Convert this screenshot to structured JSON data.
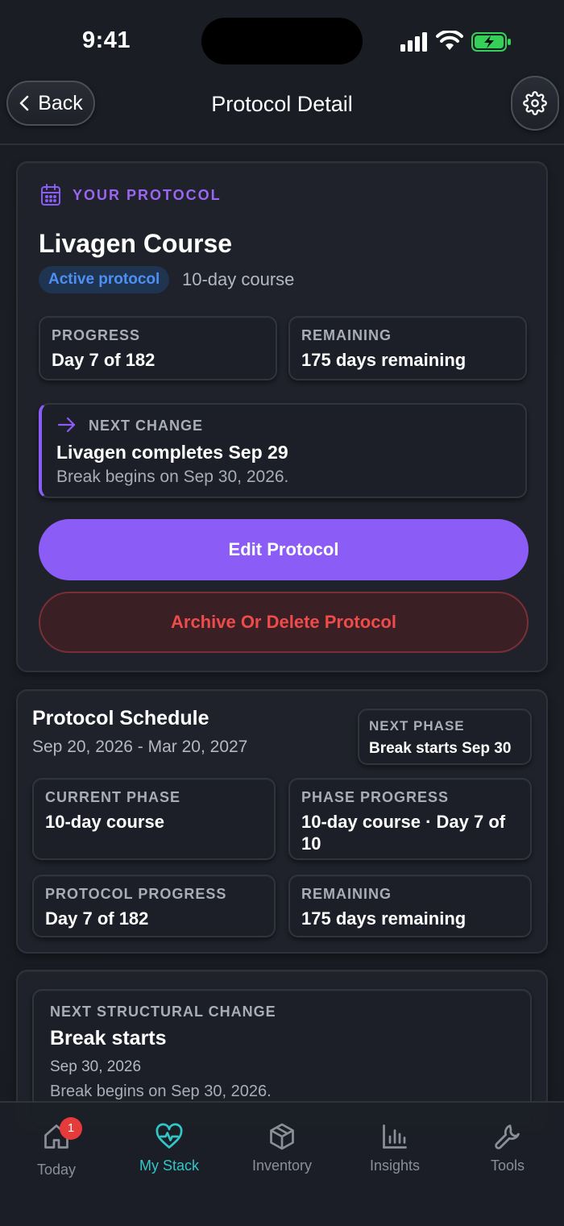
{
  "status": {
    "time": "9:41"
  },
  "nav": {
    "back_label": "Back",
    "title": "Protocol Detail"
  },
  "protocol": {
    "section_label": "YOUR PROTOCOL",
    "title": "Livagen Course",
    "badge": "Active protocol",
    "course": "10-day course",
    "progress": {
      "label": "PROGRESS",
      "value": "Day 7 of 182"
    },
    "remaining": {
      "label": "REMAINING",
      "value": "175 days remaining"
    },
    "next_change": {
      "label": "NEXT CHANGE",
      "title": "Livagen completes Sep 29",
      "subtitle": "Break begins on Sep 30, 2026."
    },
    "edit_label": "Edit Protocol",
    "archive_label": "Archive Or Delete Protocol"
  },
  "schedule": {
    "title": "Protocol Schedule",
    "range": "Sep 20, 2026 - Mar 20, 2027",
    "next_phase": {
      "label": "NEXT PHASE",
      "value": "Break starts Sep 30"
    },
    "current_phase": {
      "label": "CURRENT PHASE",
      "value": "10-day course"
    },
    "phase_progress": {
      "label": "PHASE PROGRESS",
      "value": "10-day course · Day 7 of 10"
    },
    "protocol_progress": {
      "label": "PROTOCOL PROGRESS",
      "value": "Day 7 of 182"
    },
    "remaining": {
      "label": "REMAINING",
      "value": "175 days remaining"
    }
  },
  "structural": {
    "label": "NEXT STRUCTURAL CHANGE",
    "title": "Break starts",
    "date": "Sep 30, 2026",
    "subtitle": "Break begins on Sep 30, 2026."
  },
  "tabs": [
    {
      "label": "Today",
      "icon": "home-icon",
      "badge": "1"
    },
    {
      "label": "My Stack",
      "icon": "heart-pulse-icon",
      "active": true
    },
    {
      "label": "Inventory",
      "icon": "box-icon"
    },
    {
      "label": "Insights",
      "icon": "bar-chart-icon"
    },
    {
      "label": "Tools",
      "icon": "wrench-icon"
    }
  ],
  "colors": {
    "accent": "#8b5cf6",
    "danger": "#ef4b4b",
    "active_tab": "#31c6c8",
    "badge_blue": "#4d8ff2"
  }
}
